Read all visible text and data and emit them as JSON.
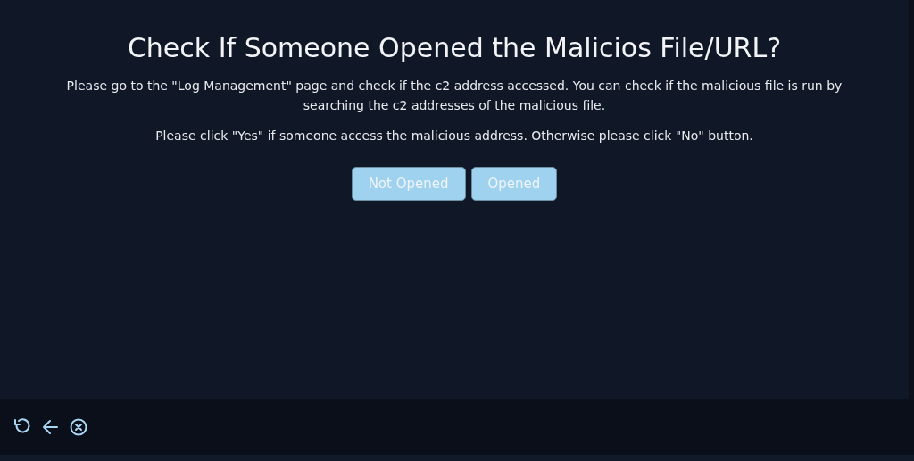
{
  "dialog": {
    "title": "Check If Someone Opened the Malicios File/URL?",
    "paragraphs": [
      "Please go to the \"Log Management\" page and check if the c2 address accessed. You can check if the malicious file is run by searching the c2 addresses of the malicious file.",
      "Please click \"Yes\" if someone access the malicious address. Otherwise please click \"No\" button."
    ],
    "buttons": [
      {
        "label": "Not Opened"
      },
      {
        "label": "Opened"
      }
    ]
  },
  "footer": {
    "icons": [
      {
        "kind": "reset"
      },
      {
        "kind": "back"
      },
      {
        "kind": "close"
      }
    ]
  }
}
